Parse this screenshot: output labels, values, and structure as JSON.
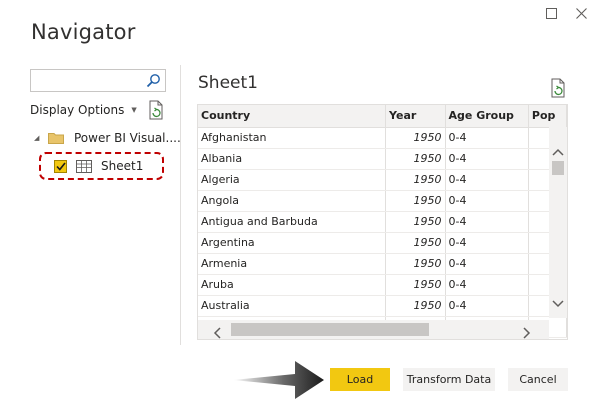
{
  "window": {
    "title": "Navigator"
  },
  "left_pane": {
    "search": {
      "value": "",
      "placeholder": ""
    },
    "display_options_label": "Display Options",
    "tree": {
      "folder_label": "Power BI Visual....",
      "sheet_label": "Sheet1",
      "sheet_checked": true
    }
  },
  "preview": {
    "title": "Sheet1",
    "columns": [
      "Country",
      "Year",
      "Age Group",
      "Pop"
    ],
    "rows": [
      [
        "Afghanistan",
        "1950",
        "0-4"
      ],
      [
        "Albania",
        "1950",
        "0-4"
      ],
      [
        "Algeria",
        "1950",
        "0-4"
      ],
      [
        "Angola",
        "1950",
        "0-4"
      ],
      [
        "Antigua and Barbuda",
        "1950",
        "0-4"
      ],
      [
        "Argentina",
        "1950",
        "0-4"
      ],
      [
        "Armenia",
        "1950",
        "0-4"
      ],
      [
        "Aruba",
        "1950",
        "0-4"
      ],
      [
        "Australia",
        "1950",
        "0-4"
      ],
      [
        "",
        "",
        ""
      ]
    ]
  },
  "footer": {
    "load_label": "Load",
    "transform_label": "Transform Data",
    "cancel_label": "Cancel"
  },
  "colors": {
    "accent": "#f2c811",
    "highlight_border": "#c00000",
    "button_bg": "#f3f2f1"
  }
}
